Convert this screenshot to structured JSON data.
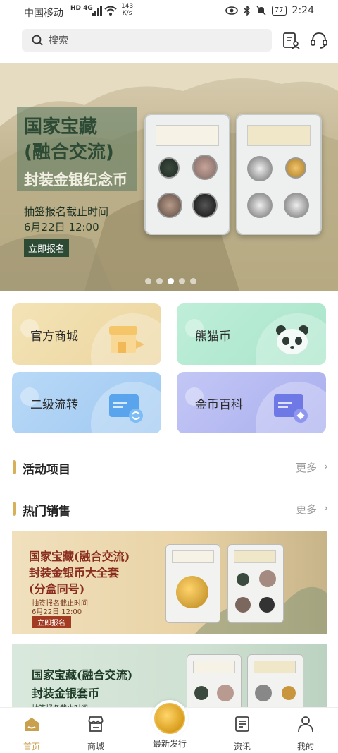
{
  "status_bar": {
    "carrier": "中国移动",
    "network": "HD 4G",
    "speed": "143",
    "speed_unit": "K/s",
    "battery": "77",
    "time": "2:24"
  },
  "search": {
    "placeholder": "搜索"
  },
  "banner": {
    "title_line1": "国家宝藏",
    "title_line2": "(融合交流)",
    "title_line3": "封装金银纪念币",
    "deadline_label": "抽签报名截止时间",
    "deadline_time": "6月22日 12:00",
    "cta": "立即报名",
    "page_count": 5,
    "active_page": 3
  },
  "grid": [
    {
      "label": "官方商城",
      "icon": "shop-icon"
    },
    {
      "label": "熊猫币",
      "icon": "panda-icon"
    },
    {
      "label": "二级流转",
      "icon": "transfer-card-icon"
    },
    {
      "label": "金币百科",
      "icon": "encyclopedia-card-icon"
    }
  ],
  "sections": {
    "activities": {
      "title": "活动项目",
      "more": "更多"
    },
    "hot_sales": {
      "title": "热门销售",
      "more": "更多"
    }
  },
  "hot_items": [
    {
      "line1": "国家宝藏(融合交流)",
      "line2": "封装金银币大全套",
      "line3": "(分盒同号)",
      "deadline_label": "抽签报名截止时间",
      "deadline_time": "6月22日 12:00",
      "cta": "立即报名"
    },
    {
      "line1": "国家宝藏(融合交流)",
      "line2": "封装金银套币",
      "deadline_label": "抽签报名截止时间"
    }
  ],
  "tabbar": {
    "home": "首页",
    "mall": "商城",
    "new_release": "最新发行",
    "news": "资讯",
    "mine": "我的"
  },
  "colors": {
    "accent": "#c9a04d",
    "banner_green": "#2d4a35",
    "hot_red": "#8a2c1e"
  }
}
